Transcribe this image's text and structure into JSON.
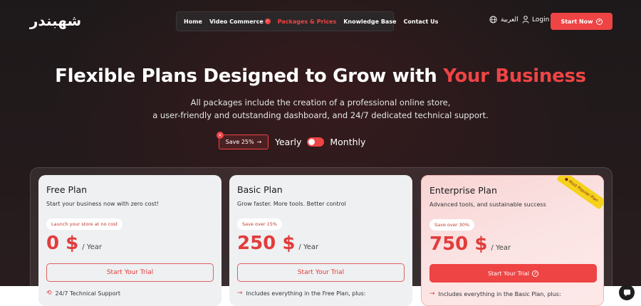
{
  "brand": {
    "logo_text": "شهبندر",
    "accent": "#ef4444"
  },
  "nav": {
    "items": [
      {
        "label": "Home"
      },
      {
        "label": "Video Commerce"
      },
      {
        "label": "Packages & Prices"
      },
      {
        "label": "Knowledge Base"
      },
      {
        "label": "Contact Us"
      }
    ]
  },
  "header": {
    "language_label": "العربية",
    "login_label": "Login",
    "start_label": "Start Now"
  },
  "hero": {
    "title_main": "Flexible Plans Designed to Grow with ",
    "title_accent": "Your Business",
    "subtitle_line1": "All packages include the creation of a professional online store,",
    "subtitle_line2": "a user-friendly and outstanding dashboard, and 24/7 dedicated technical support."
  },
  "billing": {
    "save_label": "Save 25%",
    "yearly_label": "Yearly",
    "monthly_label": "Monthly"
  },
  "plans": [
    {
      "title": "Free Plan",
      "desc": "Start your business now with zero cost!",
      "tag": "Launch your store at no cost",
      "price": "0 $",
      "unit": "/ Year",
      "cta": "Start Your Trial",
      "feature": "24/7 Technical Support"
    },
    {
      "title": "Basic Plan",
      "desc": "Grow faster. More tools. Better control",
      "tag": "Save over 15%",
      "price": "250 $",
      "unit": "/ Year",
      "cta": "Start Your Trial",
      "feature": "Includes everything in the Free Plan, plus:"
    },
    {
      "title": "Enterprise Plan",
      "desc": "Advanced tools, and sustainable success",
      "tag": "Save over 30%",
      "price": "750 $",
      "unit": "/ Year",
      "cta": "Start Your Trial",
      "feature": "Includes everything in the Basic Plan, plus:",
      "badge": "Most Popular Plan"
    }
  ]
}
